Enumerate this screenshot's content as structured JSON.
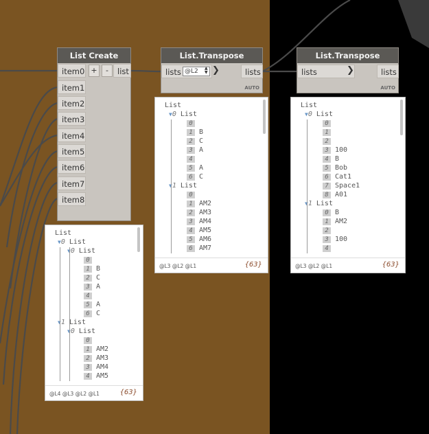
{
  "node_list_create": {
    "title": "List Create",
    "inputs": [
      "item0",
      "item1",
      "item2",
      "item3",
      "item4",
      "item5",
      "item6",
      "item7",
      "item8"
    ],
    "add_label": "+",
    "remove_label": "-",
    "output": "list"
  },
  "node_transpose1": {
    "title": "List.Transpose",
    "input": "lists",
    "level_value": "@L2",
    "output": "lists",
    "auto_label": "AUTO"
  },
  "node_transpose2": {
    "title": "List.Transpose",
    "input": "lists",
    "output": "lists",
    "auto_label": "AUTO"
  },
  "preview_list_create": {
    "root": "List",
    "rows": [
      {
        "type": "list",
        "indent": 1,
        "index": "0",
        "label": "List"
      },
      {
        "type": "list",
        "indent": 2,
        "index": "0",
        "label": "List"
      },
      {
        "type": "item",
        "indent": 3,
        "index": "0",
        "value": ""
      },
      {
        "type": "item",
        "indent": 3,
        "index": "1",
        "value": "B"
      },
      {
        "type": "item",
        "indent": 3,
        "index": "2",
        "value": "C"
      },
      {
        "type": "item",
        "indent": 3,
        "index": "3",
        "value": "A"
      },
      {
        "type": "item",
        "indent": 3,
        "index": "4",
        "value": ""
      },
      {
        "type": "item",
        "indent": 3,
        "index": "5",
        "value": "A"
      },
      {
        "type": "item",
        "indent": 3,
        "index": "6",
        "value": "C"
      },
      {
        "type": "list",
        "indent": 1,
        "index": "1",
        "label": "List"
      },
      {
        "type": "list",
        "indent": 2,
        "index": "0",
        "label": "List"
      },
      {
        "type": "item",
        "indent": 3,
        "index": "0",
        "value": ""
      },
      {
        "type": "item",
        "indent": 3,
        "index": "1",
        "value": "AM2"
      },
      {
        "type": "item",
        "indent": 3,
        "index": "2",
        "value": "AM3"
      },
      {
        "type": "item",
        "indent": 3,
        "index": "3",
        "value": "AM4"
      },
      {
        "type": "item",
        "indent": 3,
        "index": "4",
        "value": "AM5"
      }
    ],
    "levels": "@L4 @L3 @L2 @L1",
    "count": "{63}"
  },
  "preview_transpose1": {
    "root": "List",
    "rows": [
      {
        "type": "list",
        "indent": 1,
        "index": "0",
        "label": "List"
      },
      {
        "type": "item",
        "indent": 2,
        "index": "0",
        "value": ""
      },
      {
        "type": "item",
        "indent": 2,
        "index": "1",
        "value": "B"
      },
      {
        "type": "item",
        "indent": 2,
        "index": "2",
        "value": "C"
      },
      {
        "type": "item",
        "indent": 2,
        "index": "3",
        "value": "A"
      },
      {
        "type": "item",
        "indent": 2,
        "index": "4",
        "value": ""
      },
      {
        "type": "item",
        "indent": 2,
        "index": "5",
        "value": "A"
      },
      {
        "type": "item",
        "indent": 2,
        "index": "6",
        "value": "C"
      },
      {
        "type": "list",
        "indent": 1,
        "index": "1",
        "label": "List"
      },
      {
        "type": "item",
        "indent": 2,
        "index": "0",
        "value": ""
      },
      {
        "type": "item",
        "indent": 2,
        "index": "1",
        "value": "AM2"
      },
      {
        "type": "item",
        "indent": 2,
        "index": "2",
        "value": "AM3"
      },
      {
        "type": "item",
        "indent": 2,
        "index": "3",
        "value": "AM4"
      },
      {
        "type": "item",
        "indent": 2,
        "index": "4",
        "value": "AM5"
      },
      {
        "type": "item",
        "indent": 2,
        "index": "5",
        "value": "AM6"
      },
      {
        "type": "item",
        "indent": 2,
        "index": "6",
        "value": "AM7"
      }
    ],
    "levels": "@L3 @L2 @L1",
    "count": "{63}"
  },
  "preview_transpose2": {
    "root": "List",
    "rows": [
      {
        "type": "list",
        "indent": 1,
        "index": "0",
        "label": "List"
      },
      {
        "type": "item",
        "indent": 2,
        "index": "0",
        "value": ""
      },
      {
        "type": "item",
        "indent": 2,
        "index": "1",
        "value": ""
      },
      {
        "type": "item",
        "indent": 2,
        "index": "2",
        "value": ""
      },
      {
        "type": "item",
        "indent": 2,
        "index": "3",
        "value": "100"
      },
      {
        "type": "item",
        "indent": 2,
        "index": "4",
        "value": "B"
      },
      {
        "type": "item",
        "indent": 2,
        "index": "5",
        "value": "Bob"
      },
      {
        "type": "item",
        "indent": 2,
        "index": "6",
        "value": "Cat1"
      },
      {
        "type": "item",
        "indent": 2,
        "index": "7",
        "value": "Space1"
      },
      {
        "type": "item",
        "indent": 2,
        "index": "8",
        "value": "A01"
      },
      {
        "type": "list",
        "indent": 1,
        "index": "1",
        "label": "List"
      },
      {
        "type": "item",
        "indent": 2,
        "index": "0",
        "value": "B"
      },
      {
        "type": "item",
        "indent": 2,
        "index": "1",
        "value": "AM2"
      },
      {
        "type": "item",
        "indent": 2,
        "index": "2",
        "value": ""
      },
      {
        "type": "item",
        "indent": 2,
        "index": "3",
        "value": "100"
      },
      {
        "type": "item",
        "indent": 2,
        "index": "4",
        "value": ""
      }
    ],
    "levels": "@L3 @L2 @L1",
    "count": "{63}"
  }
}
